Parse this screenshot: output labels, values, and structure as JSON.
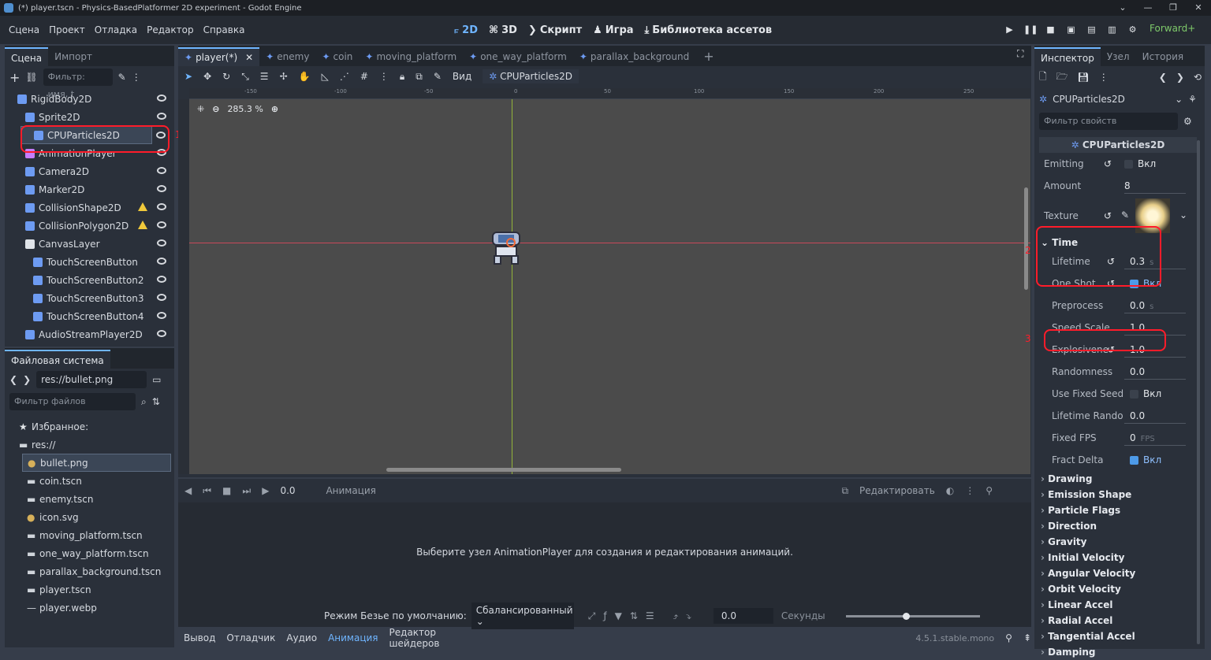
{
  "window": {
    "title": "(*) player.tscn - Physics-BasedPlatformer 2D experiment - Godot Engine",
    "controls": [
      "⌄",
      "—",
      "❐",
      "✕"
    ]
  },
  "menu": [
    "Сцена",
    "Проект",
    "Отладка",
    "Редактор",
    "Справка"
  ],
  "workspaces": [
    {
      "icon": "⟔",
      "label": "2D"
    },
    {
      "icon": "⌘",
      "label": "3D"
    },
    {
      "icon": "❯",
      "label": "Скрипт"
    },
    {
      "icon": "♟",
      "label": "Игра"
    },
    {
      "icon": "⤓",
      "label": "Библиотека ассетов"
    }
  ],
  "play_controls": [
    "▶",
    "❚❚",
    "■",
    "▣",
    "▤",
    "▥",
    "⚙"
  ],
  "renderer": "Forward+",
  "scene_panel": {
    "tabs": [
      "Сцена",
      "Импорт"
    ],
    "filter_placeholder": "Фильтр: имя, t",
    "nodes": [
      {
        "name": "RigidBody2D",
        "color": "#6d9bf2",
        "indent": 0,
        "warn": false
      },
      {
        "name": "Sprite2D",
        "color": "#6d9bf2",
        "indent": 1,
        "warn": false
      },
      {
        "name": "CPUParticles2D",
        "color": "#6d9bf2",
        "indent": 2,
        "warn": false,
        "selected": true
      },
      {
        "name": "AnimationPlayer",
        "color": "#c77dff",
        "indent": 1,
        "warn": false
      },
      {
        "name": "Camera2D",
        "color": "#6d9bf2",
        "indent": 1,
        "warn": false
      },
      {
        "name": "Marker2D",
        "color": "#6d9bf2",
        "indent": 1,
        "warn": false
      },
      {
        "name": "CollisionShape2D",
        "color": "#6d9bf2",
        "indent": 1,
        "warn": true
      },
      {
        "name": "CollisionPolygon2D",
        "color": "#6d9bf2",
        "indent": 1,
        "warn": true
      },
      {
        "name": "CanvasLayer",
        "color": "#dfe3e8",
        "indent": 1,
        "warn": false
      },
      {
        "name": "TouchScreenButton",
        "color": "#6d9bf2",
        "indent": 2,
        "warn": false
      },
      {
        "name": "TouchScreenButton2",
        "color": "#6d9bf2",
        "indent": 2,
        "warn": false
      },
      {
        "name": "TouchScreenButton3",
        "color": "#6d9bf2",
        "indent": 2,
        "warn": false
      },
      {
        "name": "TouchScreenButton4",
        "color": "#6d9bf2",
        "indent": 2,
        "warn": false
      },
      {
        "name": "AudioStreamPlayer2D",
        "color": "#6d9bf2",
        "indent": 1,
        "warn": false
      }
    ]
  },
  "fs_panel": {
    "title": "Файловая система",
    "path": "res://bullet.png",
    "filter_placeholder": "Фильтр файлов",
    "items": [
      {
        "name": "Избранное:",
        "icon": "★",
        "indent": 0
      },
      {
        "name": "res://",
        "icon": "▬",
        "indent": 0
      },
      {
        "name": "bullet.png",
        "icon": "●",
        "indent": 1,
        "selected": true
      },
      {
        "name": "coin.tscn",
        "icon": "▬",
        "indent": 1
      },
      {
        "name": "enemy.tscn",
        "icon": "▬",
        "indent": 1
      },
      {
        "name": "icon.svg",
        "icon": "●",
        "indent": 1
      },
      {
        "name": "moving_platform.tscn",
        "icon": "▬",
        "indent": 1
      },
      {
        "name": "one_way_platform.tscn",
        "icon": "▬",
        "indent": 1
      },
      {
        "name": "parallax_background.tscn",
        "icon": "▬",
        "indent": 1
      },
      {
        "name": "player.tscn",
        "icon": "▬",
        "indent": 1
      },
      {
        "name": "player.webp",
        "icon": "—",
        "indent": 1
      }
    ]
  },
  "scene_tabs": [
    "player(*)",
    "enemy",
    "coin",
    "moving_platform",
    "one_way_platform",
    "parallax_background"
  ],
  "viewport": {
    "view_label": "Вид",
    "node_label": "CPUParticles2D",
    "zoom": "285.3 %",
    "ruler_ticks": [
      "-150",
      "-100",
      "-50",
      "0",
      "50",
      "100",
      "150",
      "200",
      "250"
    ]
  },
  "animation": {
    "time": "0.0",
    "name_placeholder": "Анимация",
    "edit": "Редактировать",
    "message": "Выберите узел AnimationPlayer для создания и редактирования анимаций.",
    "bezier_label": "Режим Безье по умолчанию:",
    "bezier_value": "Сбалансированный",
    "step": "0.0",
    "units": "Секунды"
  },
  "bottom_tabs": [
    "Вывод",
    "Отладчик",
    "Аудио",
    "Анимация",
    "Редактор шейдеров"
  ],
  "version": "4.5.1.stable.mono",
  "inspector": {
    "tabs": [
      "Инспектор",
      "Узел",
      "История"
    ],
    "node": "CPUParticles2D",
    "filter_placeholder": "Фильтр свойств",
    "header": "CPUParticles2D",
    "props_top": [
      {
        "label": "Emitting",
        "value": "Вкл",
        "check": false,
        "revert": true
      },
      {
        "label": "Amount",
        "value": "8",
        "check": null,
        "revert": false
      }
    ],
    "texture_label": "Texture",
    "time_section": "Time",
    "props_time": [
      {
        "label": "Lifetime",
        "value": "0.3",
        "unit": "s",
        "check": null,
        "revert": true
      },
      {
        "label": "One Shot",
        "value": "Вкл",
        "check": true,
        "revert": true
      },
      {
        "label": "Preprocess",
        "value": "0.0",
        "unit": "s",
        "check": null,
        "revert": false
      },
      {
        "label": "Speed Scale",
        "value": "1.0",
        "check": null,
        "revert": false
      },
      {
        "label": "Explosivene",
        "value": "1.0",
        "check": null,
        "revert": true
      },
      {
        "label": "Randomness",
        "value": "0.0",
        "check": null,
        "revert": false
      },
      {
        "label": "Use Fixed Seed",
        "value": "Вкл",
        "check": false,
        "revert": false
      },
      {
        "label": "Lifetime Rando",
        "value": "0.0",
        "check": null,
        "revert": false
      },
      {
        "label": "Fixed FPS",
        "value": "0",
        "unit": "FPS",
        "check": null,
        "revert": false
      },
      {
        "label": "Fract Delta",
        "value": "Вкл",
        "check": true,
        "revert": false
      }
    ],
    "sections": [
      "Drawing",
      "Emission Shape",
      "Particle Flags",
      "Direction",
      "Gravity",
      "Initial Velocity",
      "Angular Velocity",
      "Orbit Velocity",
      "Linear Accel",
      "Radial Accel",
      "Tangential Accel",
      "Damping"
    ]
  },
  "annotations": [
    "1",
    "2",
    "3"
  ]
}
